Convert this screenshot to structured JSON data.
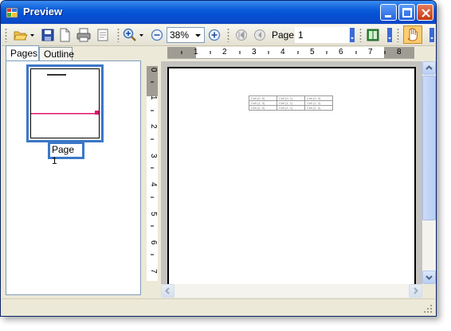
{
  "window": {
    "title": "Preview"
  },
  "toolbar": {
    "zoom_value": "38%",
    "page_label": "Page",
    "page_value": "1"
  },
  "tabs": [
    {
      "label": "Pages"
    },
    {
      "label": "Outline"
    }
  ],
  "thumbnail": {
    "label": "Page 1"
  },
  "hruler": {
    "numbers": [
      "1",
      "2",
      "3",
      "4",
      "5",
      "6",
      "7",
      "8"
    ]
  },
  "vruler": {
    "numbers": [
      "0",
      "1",
      "2",
      "3",
      "4",
      "5",
      "6",
      "7"
    ]
  },
  "page_table": {
    "rows": [
      [
        "Cell (0, 0)",
        "Cell (0, 1)",
        "Cell (0, 2)"
      ],
      [
        "Cell (1, 0)",
        "Cell (1, 1)",
        "Cell (1, 2)"
      ],
      [
        "Cell (2, 0)",
        "Cell (2, 1)",
        "Cell (2, 2)"
      ]
    ]
  },
  "colors": {
    "titlebar": "#0651d6",
    "selection": "#3c78c8",
    "viewport_bg": "#c4c3c0",
    "thumb_marker": "#e0136f"
  }
}
